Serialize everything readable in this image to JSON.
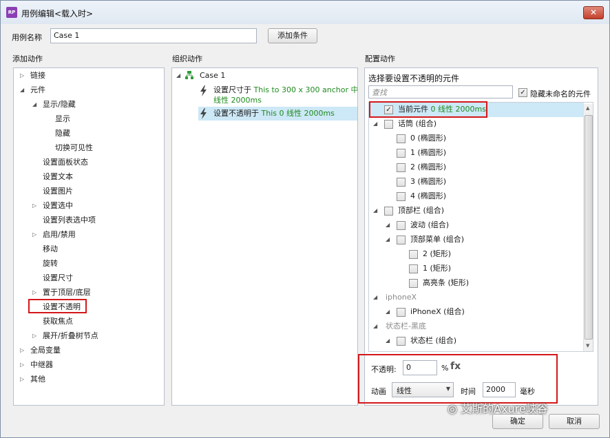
{
  "window": {
    "title": "用例编辑<载入时>",
    "app_icon": "RP",
    "close": "✕"
  },
  "case_name": {
    "label": "用例名称",
    "value": "Case 1",
    "add_condition": "添加条件"
  },
  "add_action": {
    "heading": "添加动作",
    "items": [
      {
        "label": "链接",
        "arrow": "▷"
      },
      {
        "label": "元件",
        "arrow": "◢"
      },
      {
        "label": "显示/隐藏",
        "arrow": "◢"
      },
      {
        "label": "显示"
      },
      {
        "label": "隐藏"
      },
      {
        "label": "切换可见性"
      },
      {
        "label": "设置面板状态"
      },
      {
        "label": "设置文本"
      },
      {
        "label": "设置图片"
      },
      {
        "label": "设置选中",
        "arrow": "▷"
      },
      {
        "label": "设置列表选中项"
      },
      {
        "label": "启用/禁用",
        "arrow": "▷"
      },
      {
        "label": "移动"
      },
      {
        "label": "旋转"
      },
      {
        "label": "设置尺寸"
      },
      {
        "label": "置于顶层/底层",
        "arrow": "▷"
      },
      {
        "label": "设置不透明"
      },
      {
        "label": "获取焦点"
      },
      {
        "label": "展开/折叠树节点",
        "arrow": "▷"
      },
      {
        "label": "全局变量",
        "arrow": "▷"
      },
      {
        "label": "中继器",
        "arrow": "▷"
      },
      {
        "label": "其他",
        "arrow": "▷"
      }
    ]
  },
  "organize": {
    "heading": "组织动作",
    "case_label": "Case 1",
    "actions": [
      {
        "prefix": "设置尺寸于 ",
        "detail": "This to 300 x 300 anchor 中心",
        "detail2": "线性 2000ms"
      },
      {
        "prefix": "设置不透明于 ",
        "detail": "This 0 线性 2000ms"
      }
    ]
  },
  "config": {
    "heading": "配置动作",
    "subheading": "选择要设置不透明的元件",
    "search_placeholder": "查找",
    "hide_unnamed": "隐藏未命名的元件",
    "rows": [
      {
        "label": "当前元件 ",
        "extra": "0 线性 2000ms",
        "checked": "✓"
      },
      {
        "label": "话筒 (组合)",
        "arrow": "◢"
      },
      {
        "label": "0 (椭圆形)"
      },
      {
        "label": "1 (椭圆形)"
      },
      {
        "label": "2 (椭圆形)"
      },
      {
        "label": "3 (椭圆形)"
      },
      {
        "label": "4 (椭圆形)"
      },
      {
        "label": "顶部栏 (组合)",
        "arrow": "◢"
      },
      {
        "label": "波动 (组合)",
        "arrow": "◢"
      },
      {
        "label": "顶部菜单 (组合)",
        "arrow": "◢"
      },
      {
        "label": "2 (矩形)"
      },
      {
        "label": "1 (矩形)"
      },
      {
        "label": "高亮条 (矩形)"
      },
      {
        "label": "iphoneX",
        "arrow": "◢"
      },
      {
        "label": "iPhoneX (组合)",
        "arrow": "◢"
      },
      {
        "label": "状态栏-黑底",
        "arrow": "◢"
      },
      {
        "label": "状态栏 (组合)",
        "arrow": "◢"
      }
    ],
    "opacity_label": "不透明:",
    "opacity_value": "0",
    "percent": "%",
    "fx": "fx",
    "animation_label": "动画",
    "animation_value": "线性",
    "time_label": "时间",
    "time_value": "2000",
    "ms_label": "毫秒"
  },
  "footer": {
    "ok": "确定",
    "cancel": "取消"
  },
  "watermark": "艾斯的Axure峡谷"
}
